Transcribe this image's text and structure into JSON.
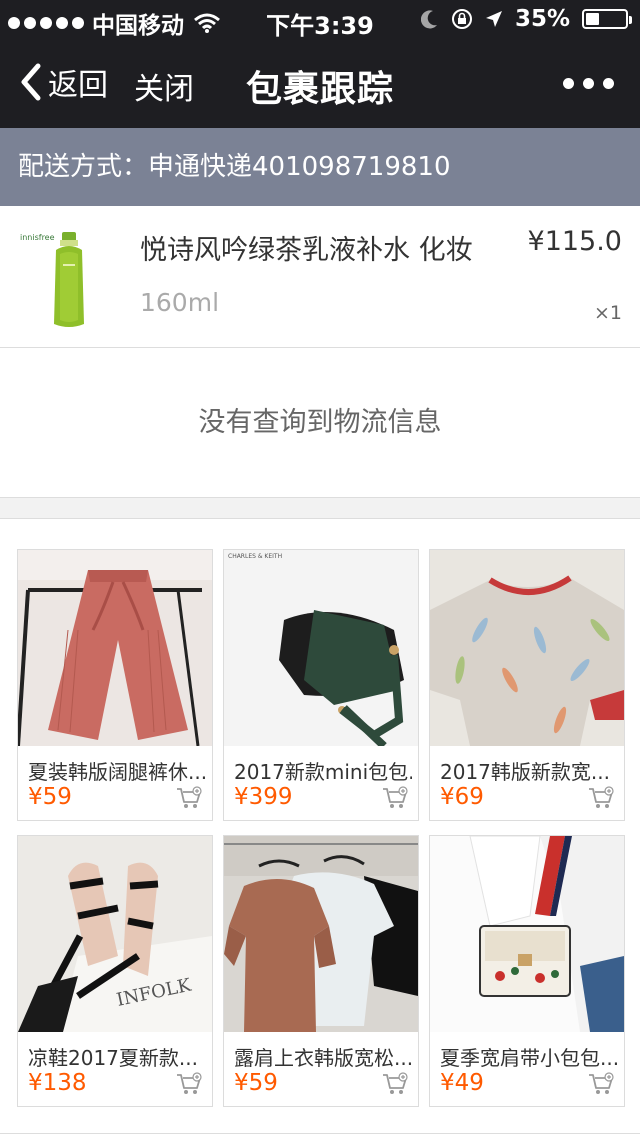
{
  "status_bar": {
    "carrier": "中国移动",
    "time": "下午3:39",
    "battery": "35%",
    "battery_level": 0.35
  },
  "nav": {
    "back_label": "返回",
    "close_label": "关闭",
    "title": "包裹跟踪"
  },
  "delivery": {
    "text": "配送方式：申通快递401098719810"
  },
  "product": {
    "name": "悦诗风吟绿茶乳液补水 化妆",
    "spec": "160ml",
    "price": "¥115.0",
    "qty": "×1"
  },
  "tracking": {
    "message": "没有查询到物流信息"
  },
  "recommendations": [
    {
      "title": "夏装韩版阔腿裤休...",
      "price": "¥59"
    },
    {
      "title": "2017新款mini包包...",
      "price": "¥399",
      "brand": "CHARLES & KEITH"
    },
    {
      "title": "2017韩版新款宽...",
      "price": "¥69"
    },
    {
      "title": "凉鞋2017夏新款...",
      "price": "¥138",
      "brand": "INFOLK"
    },
    {
      "title": "露肩上衣韩版宽松...",
      "price": "¥59"
    },
    {
      "title": "夏季宽肩带小包包...",
      "price": "¥49"
    }
  ],
  "icons": {
    "wifi": "wifi-icon",
    "moon": "moon-icon",
    "lock_rotation": "rotation-lock-icon",
    "location": "location-arrow-icon",
    "back": "chevron-left-icon",
    "more": "more-dots-icon",
    "cart": "add-to-cart-icon"
  },
  "colors": {
    "bar_bg": "#1e1e22",
    "delivery_bg": "#7b8295",
    "price_orange": "#ff5a00"
  }
}
